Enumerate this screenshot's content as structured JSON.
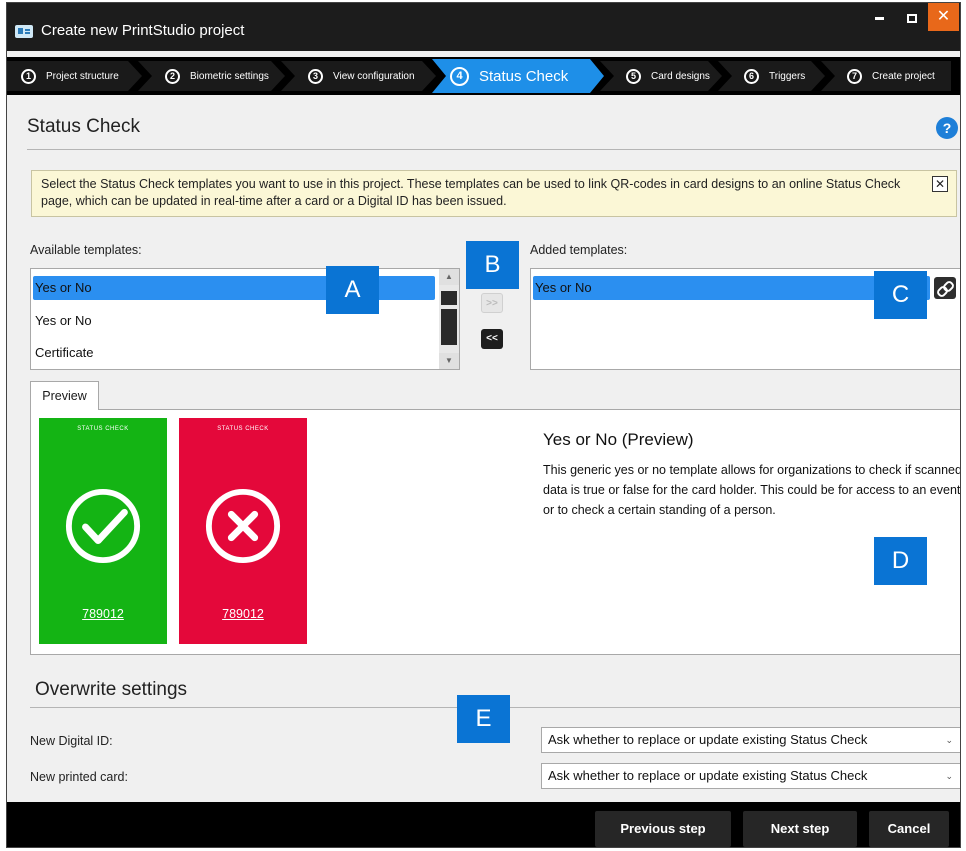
{
  "window": {
    "title": "Create new PrintStudio project",
    "minimize_icon": "minimize-icon",
    "maximize_icon": "maximize-icon",
    "close_glyph": "✕"
  },
  "steps": [
    {
      "num": "1",
      "label": "Project structure"
    },
    {
      "num": "2",
      "label": "Biometric settings"
    },
    {
      "num": "3",
      "label": "View configuration"
    },
    {
      "num": "4",
      "label": "Status Check",
      "active": true
    },
    {
      "num": "5",
      "label": "Card designs"
    },
    {
      "num": "6",
      "label": "Triggers"
    },
    {
      "num": "7",
      "label": "Create project"
    }
  ],
  "page": {
    "title": "Status Check",
    "help_glyph": "?",
    "info_text": "Select the Status Check templates you want to use in this project. These templates can be used to link QR-codes in card designs to an online Status Check page, which can be updated in real-time after a card or a Digital ID has been issued.",
    "info_close": "✕"
  },
  "available": {
    "label": "Available templates:",
    "items": [
      "Yes or No",
      "Yes or No",
      "Certificate"
    ],
    "selected_index": 0
  },
  "move_buttons": {
    "add": ">>",
    "remove": "<<"
  },
  "added": {
    "label": "Added templates:",
    "items": [
      "Yes or No"
    ]
  },
  "markers": {
    "a": "A",
    "b": "B",
    "c": "C",
    "d": "D",
    "e": "E"
  },
  "preview": {
    "tab_label": "Preview",
    "card_logo": "STATUS CHECK",
    "card_green_number": "789012",
    "card_red_number": "789012",
    "title": "Yes or No (Preview)",
    "description": "This generic yes or no template allows for organizations to check if scanned data is true or false for the card holder. This could be for access to an event or to check a certain standing of a person."
  },
  "overwrite": {
    "title": "Overwrite settings",
    "digital_id_label": "New Digital ID:",
    "digital_id_value": "Ask whether to replace or update existing Status Check",
    "printed_card_label": "New printed card:",
    "printed_card_value": "Ask whether to replace or update existing Status Check"
  },
  "footer": {
    "previous": "Previous step",
    "next": "Next step",
    "cancel": "Cancel"
  },
  "colors": {
    "accent": "#1e8fe8",
    "selection": "#2b8ff0",
    "marker": "#0a74d4",
    "card_green": "#14b414",
    "card_red": "#e4083a",
    "close_button": "#e8681a",
    "info_background": "#fbf7d6"
  }
}
